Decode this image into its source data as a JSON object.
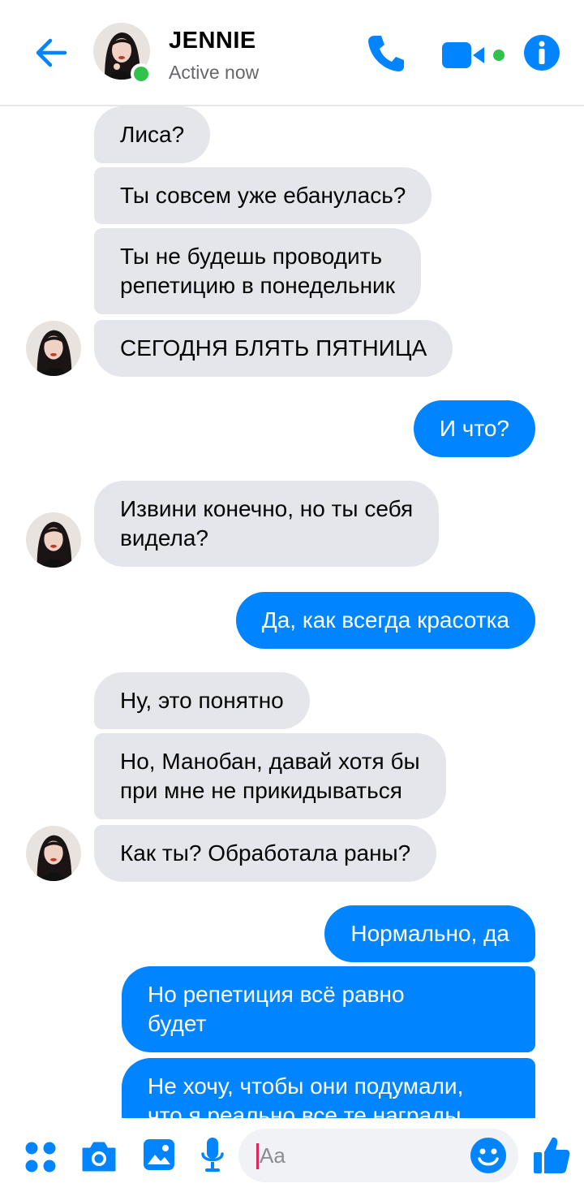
{
  "header": {
    "contact_name": "JENNIE",
    "status": "Active now",
    "icons": [
      "back-arrow-icon",
      "phone-icon",
      "video-camera-icon",
      "info-icon"
    ]
  },
  "messages": [
    {
      "side": "in",
      "text": "Лиса?"
    },
    {
      "side": "in",
      "text": "Ты совсем уже ебанулась?"
    },
    {
      "side": "in",
      "text": "Ты не будешь проводить\nрепетицию в понедельник"
    },
    {
      "side": "in",
      "text": "СЕГОДНЯ БЛЯТЬ ПЯТНИЦА"
    },
    {
      "side": "out",
      "text": "И что?"
    },
    {
      "side": "in",
      "text": "Извини конечно, но ты себя\nвидела?"
    },
    {
      "side": "out",
      "text": "Да, как всегда красотка"
    },
    {
      "side": "in",
      "text": "Ну, это понятно"
    },
    {
      "side": "in",
      "text": "Но, Манобан, давай хотя бы\nпри мне не прикидываться"
    },
    {
      "side": "in",
      "text": "Как ты? Обработала раны?"
    },
    {
      "side": "out",
      "text": "Нормально, да"
    },
    {
      "side": "out",
      "text": "Но репетиция всё равно\nбудет"
    },
    {
      "side": "out",
      "text": "Не хочу, чтобы они подумали,\nчто я реально все те награды"
    }
  ],
  "composer": {
    "placeholder": "Aa",
    "icons": [
      "menu-dots-icon",
      "camera-icon",
      "gallery-icon",
      "microphone-icon",
      "emoji-icon",
      "thumbs-up-icon"
    ]
  },
  "colors": {
    "accent": "#0084ff",
    "incoming_bubble": "#e4e6eb",
    "online": "#31c24d"
  }
}
